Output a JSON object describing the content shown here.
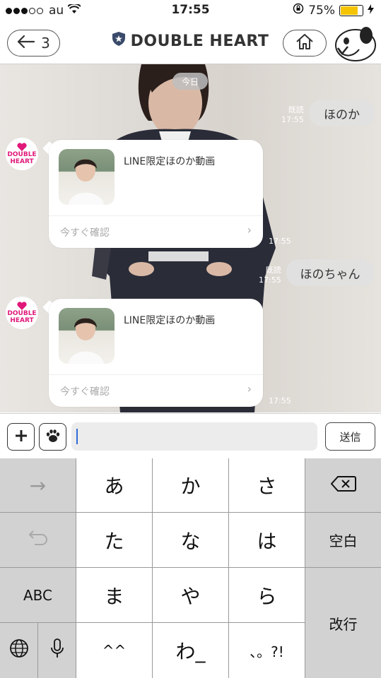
{
  "status_bar": {
    "carrier": "au",
    "time": "17:55",
    "battery_percent": "75%",
    "battery_level": 0.75,
    "signal_dots_filled": 3,
    "signal_dots_total": 5,
    "icons": [
      "wifi-icon",
      "orientation-lock-icon",
      "battery-icon",
      "charging-icon"
    ]
  },
  "nav": {
    "back_count": "3",
    "title": "DOUBLE HEART",
    "icons": [
      "back-arrow-icon",
      "shield-star-icon",
      "home-icon",
      "snoopy-sticker-icon"
    ]
  },
  "chat": {
    "day_label": "今日",
    "sender_avatar_text": [
      "DOUBLE",
      "HEART"
    ],
    "messages": [
      {
        "type": "outgoing",
        "text": "ほのか",
        "read": "既読",
        "time": "17:55"
      },
      {
        "type": "card",
        "title": "LINE限定ほのか動画",
        "action": "今すぐ確認",
        "time": "17:55"
      },
      {
        "type": "outgoing",
        "text": "ほのちゃん",
        "read": "既読",
        "time": "17:55"
      },
      {
        "type": "card",
        "title": "LINE限定ほのか動画",
        "action": "今すぐ確認",
        "time": "17:55"
      }
    ]
  },
  "input_bar": {
    "send_label": "送信",
    "icons": [
      "plus-icon",
      "paw-icon"
    ]
  },
  "keyboard": {
    "rows": [
      [
        "→",
        "あ",
        "か",
        "さ",
        "⌫"
      ],
      [
        "↶",
        "た",
        "な",
        "は",
        "空白"
      ],
      [
        "ABC",
        "ま",
        "や",
        "ら",
        "改行"
      ],
      [
        "globe",
        "mic",
        "^^",
        "わ_",
        "、。?!"
      ]
    ],
    "labels": {
      "next": "→",
      "a": "あ",
      "ka": "か",
      "sa": "さ",
      "ta": "た",
      "na": "な",
      "ha": "は",
      "ma": "ま",
      "ya": "や",
      "ra": "ら",
      "kaomoji": "^^",
      "wa": "わ_",
      "punct": "、。?!",
      "space": "空白",
      "abc": "ABC",
      "enter": "改行"
    }
  }
}
